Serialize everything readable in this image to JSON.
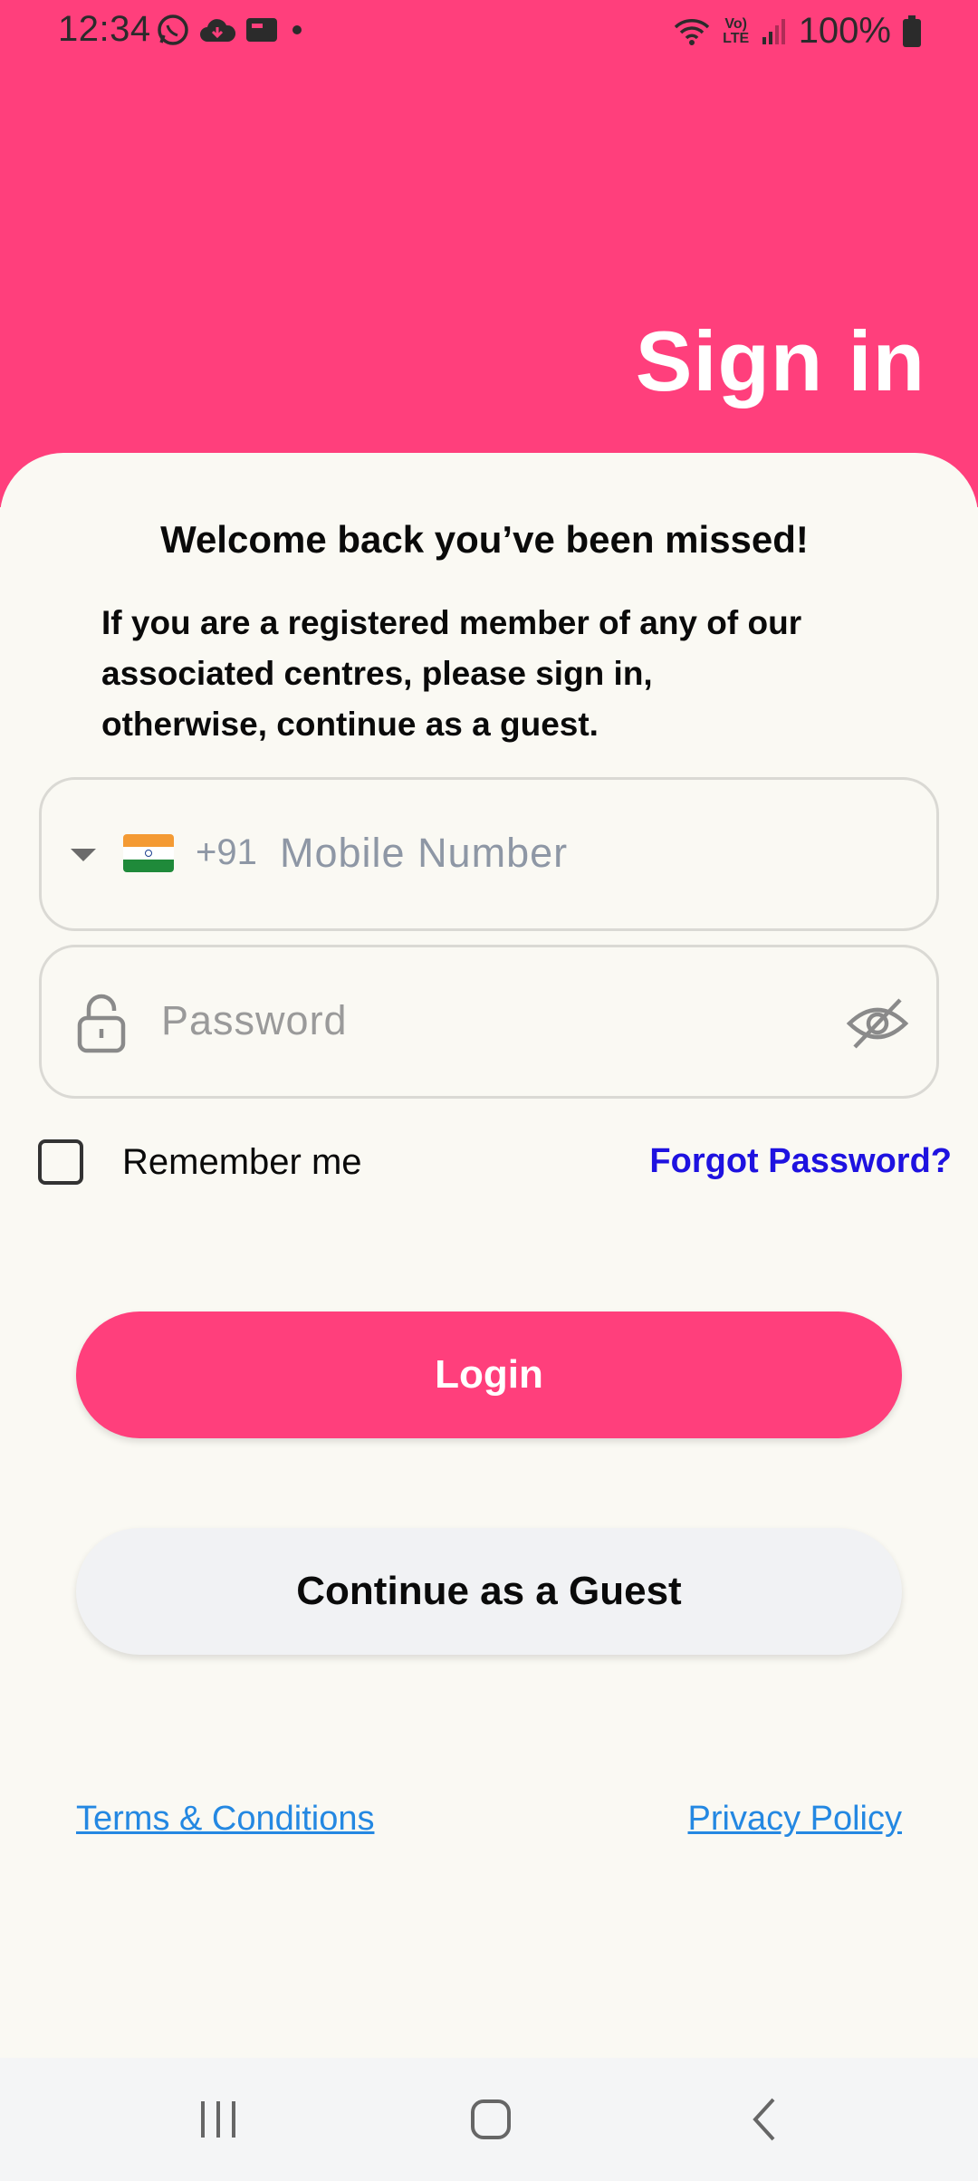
{
  "status_bar": {
    "time": "12:34",
    "battery": "100%",
    "icons": [
      "whatsapp-icon",
      "cloud-sync-icon",
      "card-icon",
      "dot-icon",
      "wifi-icon",
      "volte-icon",
      "signal-icon",
      "battery-icon"
    ],
    "volte_label_top": "Vo)",
    "volte_label_bottom": "LTE"
  },
  "header": {
    "title": "Sign in",
    "color": "#FF3F7C"
  },
  "welcome": {
    "heading": "Welcome back you’ve been missed!",
    "line1": "If you are a registered member of any of our",
    "line2": "associated centres, please sign in,",
    "line3": "otherwise, continue as a guest."
  },
  "form": {
    "country_code": "+91",
    "mobile_placeholder": "Mobile Number",
    "password_placeholder": "Password",
    "remember_label": "Remember me",
    "remember_checked": false,
    "forgot_label": "Forgot Password?"
  },
  "buttons": {
    "login": "Login",
    "guest": "Continue as a Guest"
  },
  "links": {
    "terms": "Terms & Conditions",
    "privacy": "Privacy Policy"
  },
  "colors": {
    "accent": "#FF3F7C",
    "link": "#2488E2",
    "forgot": "#1E12E0",
    "background": "#FAF9F3"
  }
}
